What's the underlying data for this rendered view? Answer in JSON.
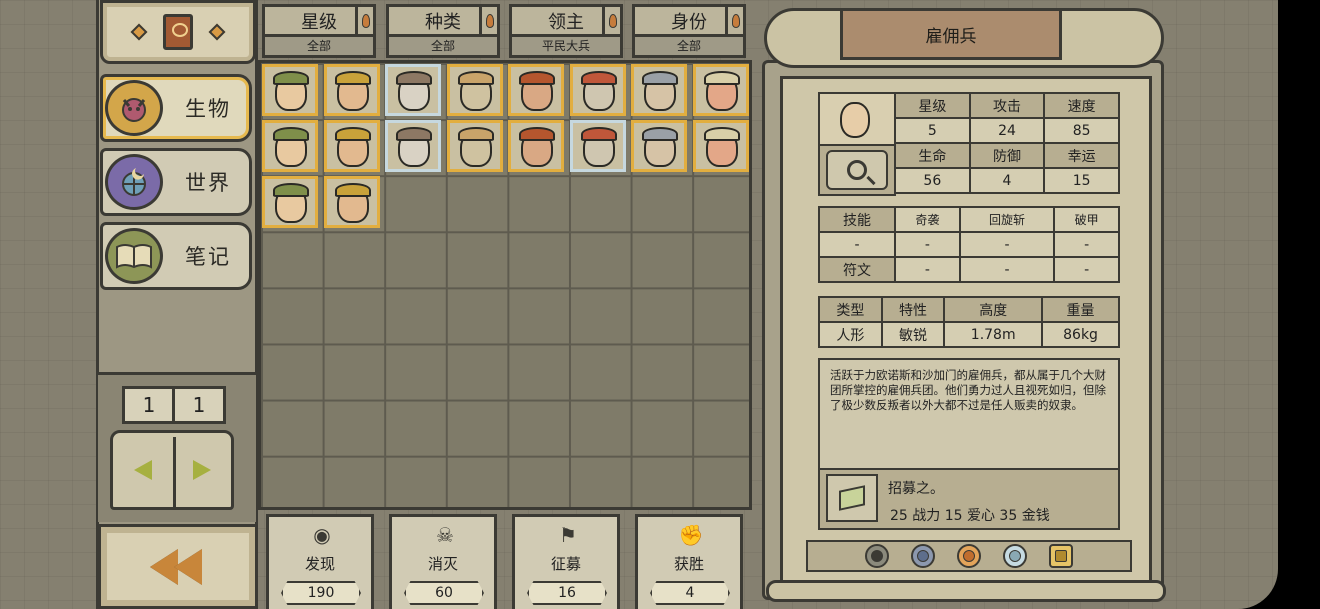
{
  "filters": [
    {
      "label": "星级",
      "value": "全部"
    },
    {
      "label": "种类",
      "value": "全部"
    },
    {
      "label": "领主",
      "value": "平民大兵"
    },
    {
      "label": "身份",
      "value": "全部"
    }
  ],
  "sidebar": {
    "items": [
      {
        "label": "生物",
        "icon": "demon-icon",
        "active": true
      },
      {
        "label": "世界",
        "icon": "globe-icon",
        "active": false
      },
      {
        "label": "笔记",
        "icon": "open-book-icon",
        "active": false
      }
    ]
  },
  "pager": {
    "current": "1",
    "total": "1"
  },
  "creatures": [
    {
      "name": "creature-1",
      "frame": "gold"
    },
    {
      "name": "creature-2",
      "frame": "gold"
    },
    {
      "name": "creature-3",
      "frame": "silver"
    },
    {
      "name": "creature-4",
      "frame": "gold"
    },
    {
      "name": "creature-5",
      "frame": "gold"
    },
    {
      "name": "creature-6",
      "frame": "gold"
    },
    {
      "name": "creature-7",
      "frame": "gold"
    },
    {
      "name": "creature-8",
      "frame": "gold"
    },
    {
      "name": "creature-9",
      "frame": "gold"
    },
    {
      "name": "creature-10",
      "frame": "gold"
    },
    {
      "name": "creature-11",
      "frame": "silver"
    },
    {
      "name": "creature-12",
      "frame": "gold"
    },
    {
      "name": "creature-13",
      "frame": "gold"
    },
    {
      "name": "creature-14",
      "frame": "silver"
    },
    {
      "name": "creature-15",
      "frame": "gold"
    },
    {
      "name": "creature-16",
      "frame": "gold"
    },
    {
      "name": "creature-17",
      "frame": "gold"
    },
    {
      "name": "creature-18",
      "frame": "gold"
    }
  ],
  "stats": [
    {
      "label": "发现",
      "value": "190",
      "icon": "eye-icon"
    },
    {
      "label": "消灭",
      "value": "60",
      "icon": "skull-icon"
    },
    {
      "label": "征募",
      "value": "16",
      "icon": "flag-icon"
    },
    {
      "label": "获胜",
      "value": "4",
      "icon": "fist-icon"
    }
  ],
  "detail": {
    "title": "雇佣兵",
    "attrs_row1": {
      "headers": [
        "星级",
        "攻击",
        "速度"
      ],
      "values": [
        "5",
        "24",
        "85"
      ]
    },
    "attrs_row2": {
      "headers": [
        "生命",
        "防御",
        "幸运"
      ],
      "values": [
        "56",
        "4",
        "15"
      ]
    },
    "skills": {
      "label": "技能",
      "names": [
        "奇袭",
        "回旋斩",
        "破甲"
      ],
      "values": [
        "-",
        "-",
        "-",
        "-"
      ]
    },
    "runes": {
      "label": "符文",
      "values": [
        "-",
        "-",
        "-"
      ]
    },
    "traits": {
      "headers": [
        "类型",
        "特性",
        "高度",
        "重量"
      ],
      "values": [
        "人形",
        "敏锐",
        "1.78m",
        "86kg"
      ]
    },
    "description": "活跃于力欧诺斯和沙加门的雇佣兵，都从属于几个大财团所掌控的雇佣兵团。他们勇力过人且视死如归，但除了极少数反叛者以外大都不过是任人贩卖的奴隶。",
    "recruit_title": "招募之。",
    "recruit_cost": "25 战力 15 爱心 35 金钱"
  },
  "badges": [
    "bronze-badge-icon",
    "silver-badge-icon",
    "gold-badge-icon",
    "platinum-badge-icon",
    "lock-icon"
  ],
  "colors": {
    "gold_frame": "#e2ae3f",
    "silver_frame": "#c6d8df",
    "parchment": "#cfc7a9",
    "ink": "#3b3a34"
  }
}
